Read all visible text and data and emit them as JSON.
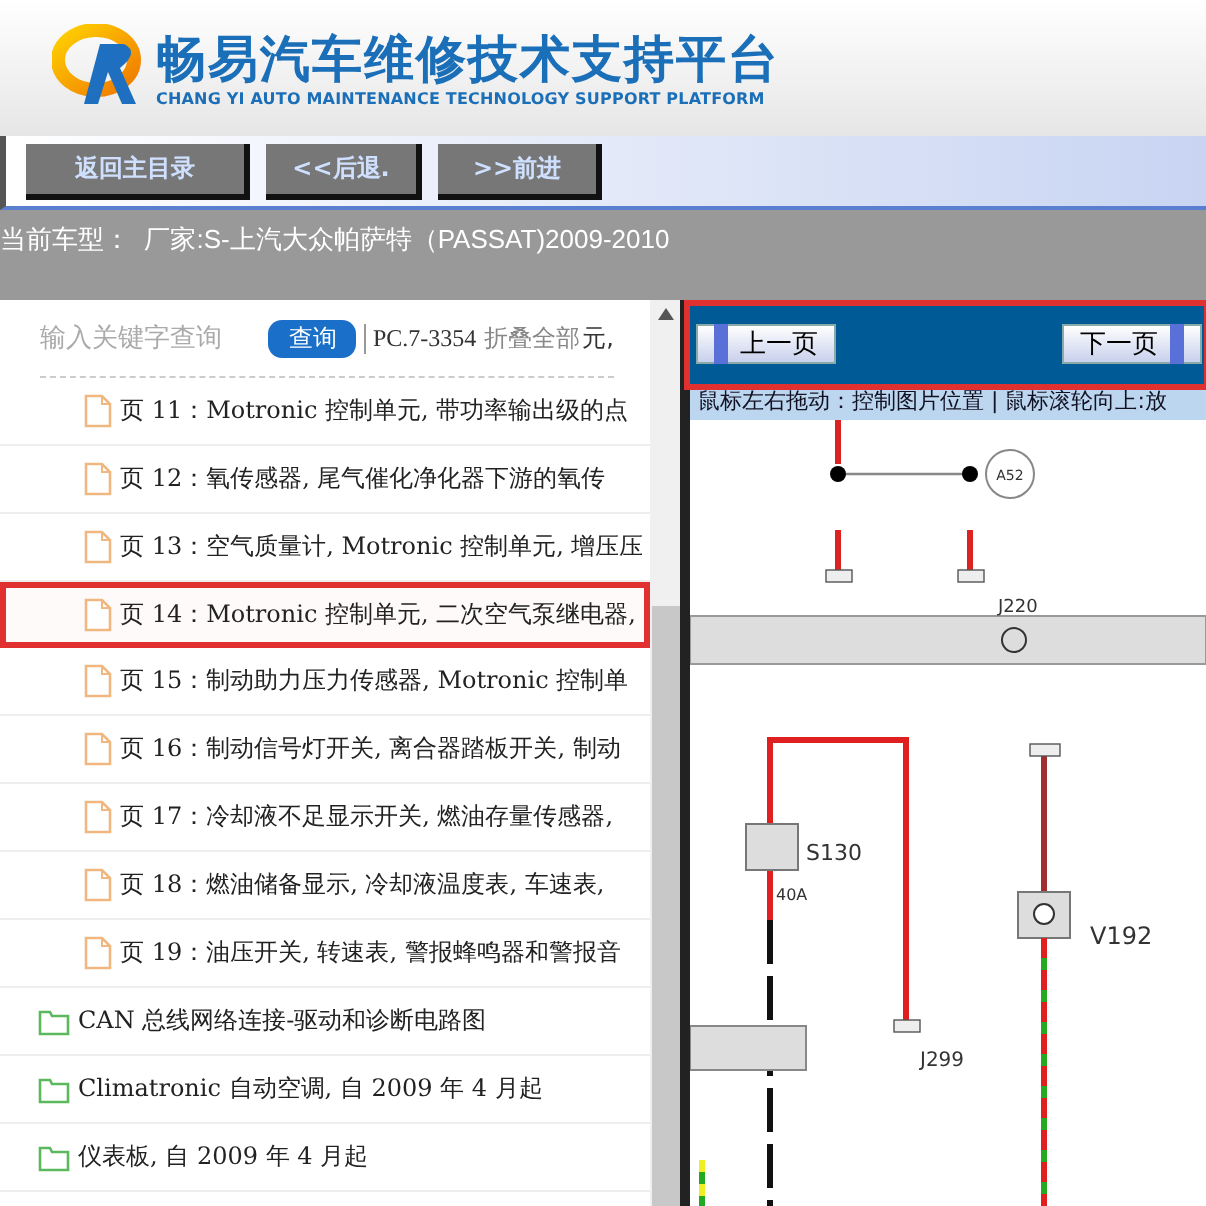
{
  "header": {
    "title": "畅易汽车维修技术支持平台",
    "subtitle": "CHANG YI AUTO MAINTENANCE TECHNOLOGY SUPPORT PLATFORM"
  },
  "nav_buttons": [
    "返回主目录",
    "<<后退.",
    ">>前进"
  ],
  "model_bar": {
    "text": "当前车型：  厂家:S-上汽大众帕萨特（PASSAT)2009-2010"
  },
  "search": {
    "placeholder": "输入关键字查询",
    "button": "查询",
    "code": "PC.7-3354",
    "collapse_link": "折叠全部",
    "overflow_text": "元,"
  },
  "tree": [
    {
      "kind": "page",
      "text": "页 11：Motronic 控制单元, 带功率输出级的点",
      "highlighted": false
    },
    {
      "kind": "page",
      "text": "页 12：氧传感器, 尾气催化净化器下游的氧传",
      "highlighted": false
    },
    {
      "kind": "page",
      "text": "页 13：空气质量计, Motronic 控制单元, 增压压",
      "highlighted": false
    },
    {
      "kind": "page",
      "text": "页 14：Motronic 控制单元, 二次空气泵继电器,",
      "highlighted": true
    },
    {
      "kind": "page",
      "text": "页 15：制动助力压力传感器, Motronic 控制单",
      "highlighted": false
    },
    {
      "kind": "page",
      "text": "页 16：制动信号灯开关, 离合器踏板开关, 制动",
      "highlighted": false
    },
    {
      "kind": "page",
      "text": "页 17：冷却液不足显示开关, 燃油存量传感器,",
      "highlighted": false
    },
    {
      "kind": "page",
      "text": "页 18：燃油储备显示, 冷却液温度表, 车速表,",
      "highlighted": false
    },
    {
      "kind": "page",
      "text": "页 19：油压开关, 转速表, 警报蜂鸣器和警报音",
      "highlighted": false
    },
    {
      "kind": "folder",
      "text": "CAN 总线网络连接-驱动和诊断电路图",
      "highlighted": false
    },
    {
      "kind": "folder",
      "text": "Climatronic 自动空调, 自 2009 年 4 月起",
      "highlighted": false
    },
    {
      "kind": "folder",
      "text": "仪表板, 自 2009 年 4 月起",
      "highlighted": false
    }
  ],
  "viewer": {
    "prev_button": "上一页",
    "next_button": "下一页",
    "pager_highlighted": true,
    "hint": "鼠标左右拖动：控制图片位置 | 鼠标滚轮向上:放",
    "diagram_labels": [
      "A52",
      "J220",
      "S130",
      "40A",
      "V192",
      "J299"
    ]
  }
}
